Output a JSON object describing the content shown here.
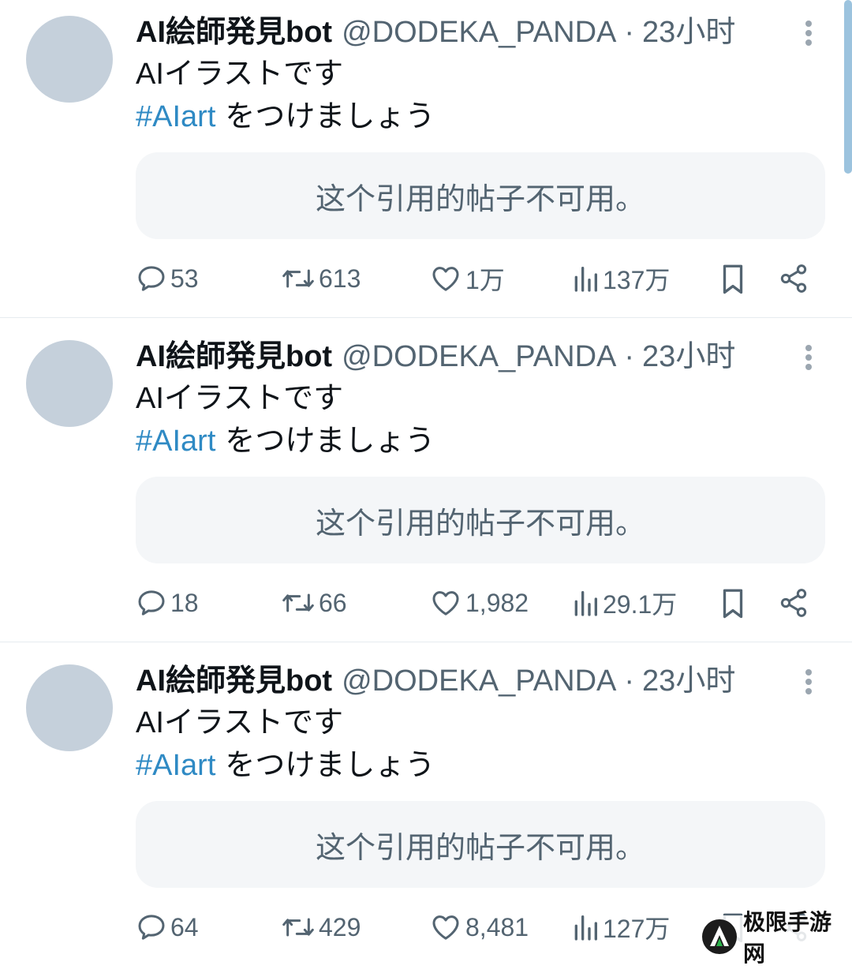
{
  "tweets": [
    {
      "name": "AI絵師発見bot",
      "handle": "@DODEKA_PANDA",
      "separator": "·",
      "time": "23小时",
      "text_line1": "AIイラストです",
      "hashtag": "#AIart",
      "text_line2": "をつけましょう",
      "quote_unavailable": "这个引用的帖子不可用。",
      "replies": "53",
      "retweets": "613",
      "likes": "1万",
      "views": "137万"
    },
    {
      "name": "AI絵師発見bot",
      "handle": "@DODEKA_PANDA",
      "separator": "·",
      "time": "23小时",
      "text_line1": "AIイラストです",
      "hashtag": "#AIart",
      "text_line2": "をつけましょう",
      "quote_unavailable": "这个引用的帖子不可用。",
      "replies": "18",
      "retweets": "66",
      "likes": "1,982",
      "views": "29.1万"
    },
    {
      "name": "AI絵師発見bot",
      "handle": "@DODEKA_PANDA",
      "separator": "·",
      "time": "23小时",
      "text_line1": "AIイラストです",
      "hashtag": "#AIart",
      "text_line2": "をつけましょう",
      "quote_unavailable": "这个引用的帖子不可用。",
      "replies": "64",
      "retweets": "429",
      "likes": "8,481",
      "views": "127万"
    }
  ],
  "icons": {
    "reply": "reply-icon",
    "retweet": "retweet-icon",
    "like": "heart-icon",
    "views": "views-bar-chart-icon",
    "bookmark": "bookmark-icon",
    "share": "share-icon",
    "more": "more-vertical-icon"
  },
  "colors": {
    "hashtag": "#2f8ac4",
    "secondary_text": "#536471",
    "avatar_placeholder": "#c5d0db",
    "quote_background": "#f4f6f8",
    "divider": "#e6ebef"
  },
  "watermark": {
    "text": "极限手游网"
  }
}
